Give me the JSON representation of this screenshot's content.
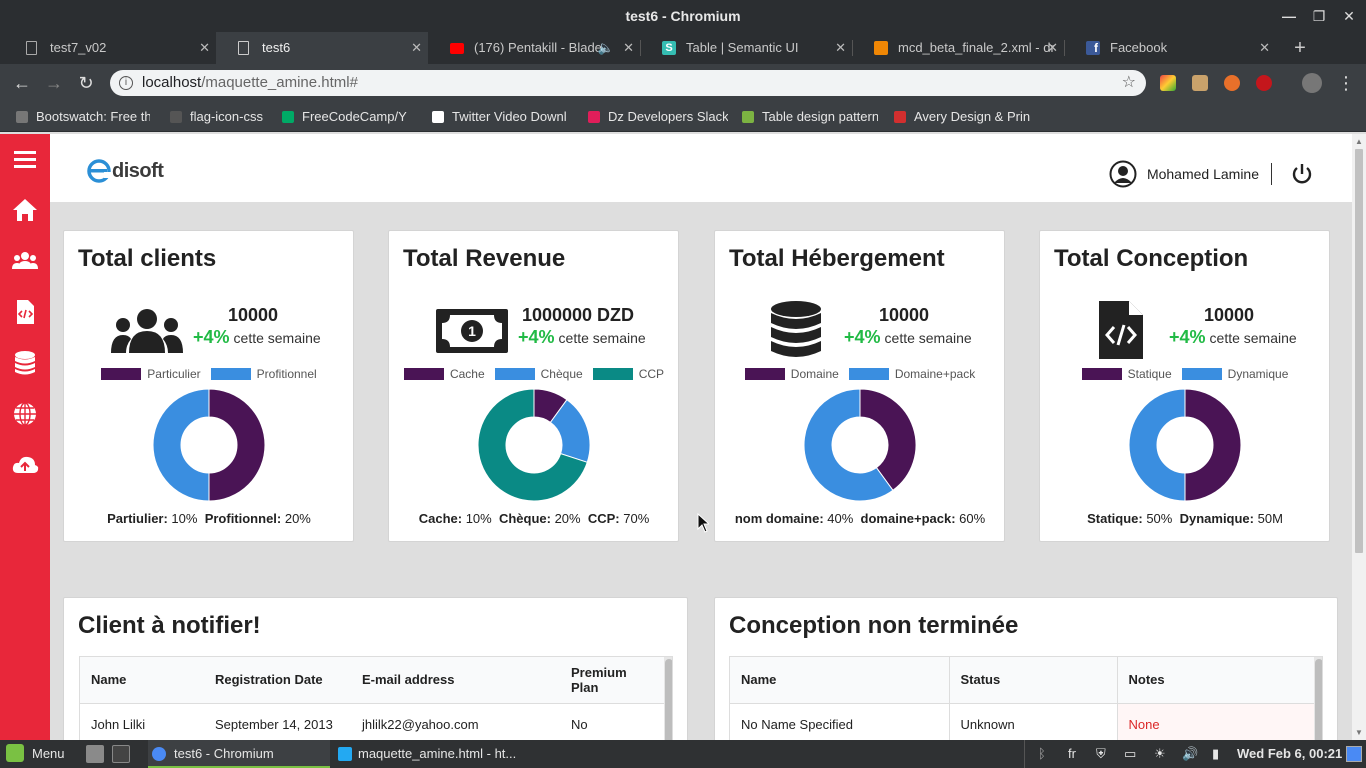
{
  "browser": {
    "window_title": "test6 - Chromium",
    "tabs": [
      {
        "label": "test7_v02"
      },
      {
        "label": "test6"
      },
      {
        "label": "(176) Pentakill - Blade"
      },
      {
        "label": "Table | Semantic UI"
      },
      {
        "label": "mcd_beta_finale_2.xml - dr"
      },
      {
        "label": "Facebook"
      }
    ],
    "url_host": "localhost",
    "url_path": "/maquette_amine.html#",
    "bookmarks": [
      {
        "label": "Bootswatch: Free th"
      },
      {
        "label": "flag-icon-css"
      },
      {
        "label": "FreeCodeCamp/Y"
      },
      {
        "label": "Twitter Video Downl"
      },
      {
        "label": "Dz Developers Slack"
      },
      {
        "label": "Table design pattern"
      },
      {
        "label": "Avery Design & Prin"
      }
    ]
  },
  "app": {
    "logo_text": "disoft",
    "user_name": "Mohamed Lamine",
    "cards": [
      {
        "title": "Total clients",
        "value": "10000",
        "pct": "+4%",
        "week": "cette semaine",
        "legend": [
          "Particulier",
          "Profitionnel"
        ],
        "caption": [
          {
            "k": "Partiulier:",
            "v": " 10%"
          },
          {
            "k": "Profitionnel:",
            "v": " 20%"
          }
        ],
        "donut": [
          50,
          50
        ]
      },
      {
        "title": "Total Revenue",
        "value": "1000000 DZD",
        "pct": "+4%",
        "week": "cette semaine",
        "legend": [
          "Cache",
          "Chèque",
          "CCP"
        ],
        "caption": [
          {
            "k": "Cache:",
            "v": " 10%"
          },
          {
            "k": "Chèque:",
            "v": " 20%"
          },
          {
            "k": "CCP:",
            "v": " 70%"
          }
        ],
        "donut": [
          10,
          20,
          70
        ]
      },
      {
        "title": "Total Hébergement",
        "value": "10000",
        "pct": "+4%",
        "week": "cette semaine",
        "legend": [
          "Domaine",
          "Domaine+pack"
        ],
        "caption": [
          {
            "k": "nom domaine:",
            "v": " 40%"
          },
          {
            "k": "domaine+pack:",
            "v": " 60%"
          }
        ],
        "donut": [
          40,
          60
        ]
      },
      {
        "title": "Total Conception",
        "value": "10000",
        "pct": "+4%",
        "week": "cette semaine",
        "legend": [
          "Statique",
          "Dynamique"
        ],
        "caption": [
          {
            "k": "Statique:",
            "v": " 50%"
          },
          {
            "k": "Dynamique:",
            "v": " 50M"
          }
        ],
        "donut": [
          50,
          50
        ]
      }
    ],
    "notify": {
      "title": "Client à notifier!",
      "headers": [
        "Name",
        "Registration Date",
        "E-mail address",
        "Premium Plan"
      ],
      "rows": [
        [
          "John Lilki",
          "September 14, 2013",
          "jhlilk22@yahoo.com",
          "No"
        ]
      ]
    },
    "conception": {
      "title": "Conception non terminée",
      "headers": [
        "Name",
        "Status",
        "Notes"
      ],
      "rows": [
        [
          "No Name Specified",
          "Unknown",
          "None"
        ]
      ]
    }
  },
  "taskbar": {
    "menu": "Menu",
    "windows": [
      "test6 - Chromium",
      "maquette_amine.html - ht..."
    ],
    "lang": "fr",
    "clock": "Wed Feb  6, 00:21"
  },
  "colors": {
    "purple": "#4a1455",
    "blue": "#3a8ee0",
    "teal": "#0a8a85",
    "accent": "#e8273a",
    "green": "#21ba45",
    "notes_red": "#db2828"
  }
}
